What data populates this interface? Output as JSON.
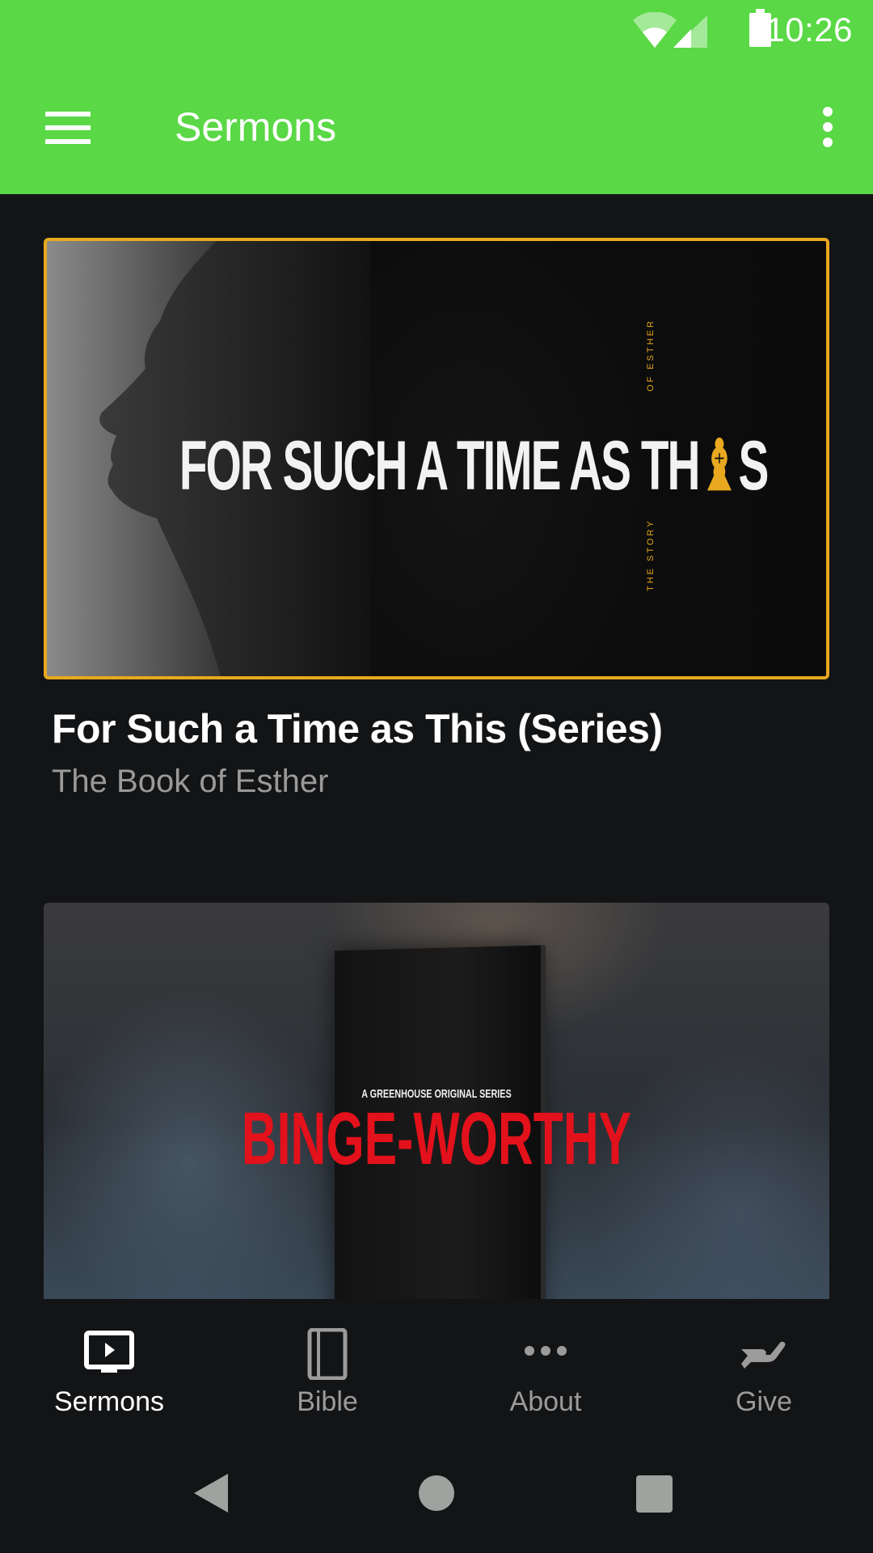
{
  "status_bar": {
    "time": "10:26",
    "icons": [
      "wifi-icon",
      "cell-signal-icon",
      "battery-icon"
    ]
  },
  "toolbar": {
    "title": "Sermons",
    "menu_icon": "hamburger-menu-icon",
    "overflow_icon": "more-vert-icon"
  },
  "sermons": [
    {
      "title": "For Such a Time as This (Series)",
      "subtitle": "The Book of Esther",
      "artwork": {
        "headline_main": "FOR SUCH A TIME AS TH",
        "headline_accent": "♝",
        "headline_end": "S",
        "side_top": "OF ESTHER",
        "side_bottom": "THE STORY",
        "accent_color": "#e8a81f"
      },
      "selected": true
    },
    {
      "title": "",
      "subtitle": "",
      "artwork": {
        "kicker": "A GREENHOUSE ORIGINAL SERIES",
        "headline": "BINGE-WORTHY",
        "accent_color": "#e3111b"
      },
      "selected": false
    }
  ],
  "bottom_nav": {
    "items": [
      {
        "label": "Sermons",
        "icon": "tv-play-icon",
        "active": true
      },
      {
        "label": "Bible",
        "icon": "book-icon",
        "active": false
      },
      {
        "label": "About",
        "icon": "more-horiz-icon",
        "active": false
      },
      {
        "label": "Give",
        "icon": "giving-hand-icon",
        "active": false
      }
    ]
  },
  "system_nav": {
    "back": "back-icon",
    "home": "home-icon",
    "recents": "recents-icon"
  },
  "colors": {
    "brand_green": "#5ad846",
    "background": "#131416",
    "selected_border": "#e8a81f",
    "inactive_text": "#9b9b9b"
  }
}
